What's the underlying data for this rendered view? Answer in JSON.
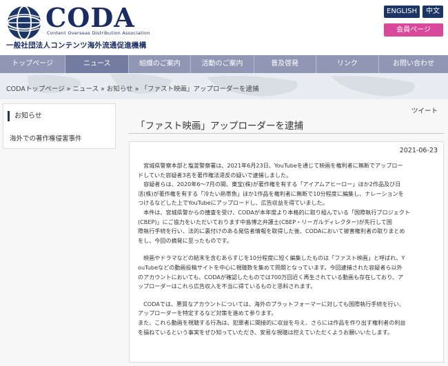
{
  "header": {
    "logo_text": "CODA",
    "logo_subtitle": "Content Overseas Distribution Association",
    "org_name": "一般社団法人コンテンツ海外流通促進機構",
    "lang_english": "ENGLISH",
    "lang_chinese": "中文",
    "member_page": "会員ページ"
  },
  "nav": {
    "items": [
      "トップページ",
      "ニュース",
      "組織のご案内",
      "活動のご案内",
      "普及啓発",
      "リンク",
      "お問い合わせ"
    ],
    "active_index": 1
  },
  "breadcrumb": "CODAトップページ » ニュース » お知らせ » 「ファスト映画」アップローダーを逮捕",
  "sidebar": {
    "title": "お知らせ",
    "link": "海外での著作権侵害事件"
  },
  "tweet_label": "ツイート",
  "article": {
    "title": "「ファスト映画」アップローダーを逮捕",
    "date": "2021-06-23",
    "lines": [
      "　宮城県警察本部と塩釜警察署は、2021年6月23日、YouTubeを通じて映画を権利者に無断でアップロー",
      "ドしていた容疑者3名を著作権法違反の疑いで逮捕しました。",
      "　容疑者らは、2020年6～7月の間、東宝(株)が著作権を有する「アイアムアヒーロー」ほか2作品及び日",
      "活(株)が著作権を有する「冷たい熱帯魚」ほか1作品を権利者に無断で10分程度に編集し、ナレーションを",
      "つけるなどした上でYouTubeにアップロードし、広告収益を得ていました。",
      "　本件は、宮城県警からの捜査を受け、CODAが本年度より本格的に取り組んでいる「国際執行プロジェクト",
      "(CBEP)」にご協力をいただいております中島博之弁護士(CBEP・リーガルディレクター)が先行して国",
      "際執行手続を行い、法的に裏付けのある発信者情報を取得した後、CODAにおいて被害権利者の取りまとめ",
      "をし、今回の摘発に至ったものです。",
      "",
      "　映画やドラマなどの結末を含むあらすじを10分程度に短く編集したものは「ファスト映画」と呼ばれ、Y",
      "ouTubeなどの動画投稿サイトを中心に視聴数を集めて問題となっています。今回逮捕された容疑者ら以外",
      "のアカウントにおいても、CODAが確認したものでは700万回近く再生されている動画も存在しており、ア",
      "ップローダーはこれら広告収入を不当に得ているものと思料されます。",
      "",
      "　CODAでは、悪質なアカウントについては、海外のプラットフォーマーに対しても国際執行手続を行い、",
      "アップローダーを特定するなど対策を進めて参ります。",
      "また、これら動画を視聴する行為は、犯罪者に間接的に収益を与え、さらには作品を作り出す権利者の利益",
      "を損ねているという事実をぜひ知っていただき、安易な視聴は控えていただくようお願いいたします。"
    ]
  }
}
